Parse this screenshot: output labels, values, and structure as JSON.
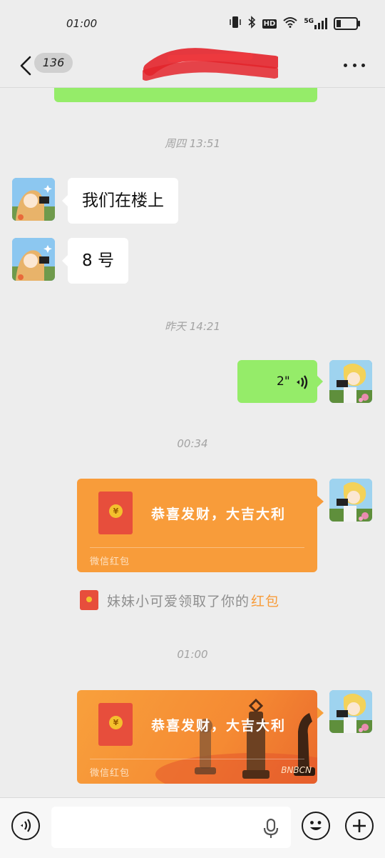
{
  "status_bar": {
    "time": "01:00",
    "icons": [
      "vibrate-icon",
      "bluetooth-icon",
      "hd-icon",
      "wifi-icon",
      "5g-signal-icon",
      "battery-icon"
    ],
    "hd_label": "HD",
    "network_label": "5G"
  },
  "header": {
    "unread_count": "136",
    "contact_name": "",
    "more_icon": "more-icon"
  },
  "timestamps": {
    "t1": "周四 13:51",
    "t2": "昨天 14:21",
    "t3": "00:34",
    "t4": "01:00"
  },
  "messages": {
    "m1": "我们在楼上",
    "m2": "8 号",
    "voice_duration": "2\""
  },
  "red_packets": {
    "rp1_title": "恭喜发财，大吉大利",
    "rp1_footer": "微信红包",
    "rp2_title": "恭喜发财，大吉大利",
    "rp2_footer": "微信红包",
    "rp2_brand": "BNBCN"
  },
  "notice": {
    "text": "妹妹小可爱领取了你的",
    "link": "红包"
  },
  "input_bar": {
    "placeholder": ""
  },
  "colors": {
    "sent_bubble": "#95ec69",
    "red_packet": "#f89c3a",
    "background": "#ededed"
  }
}
